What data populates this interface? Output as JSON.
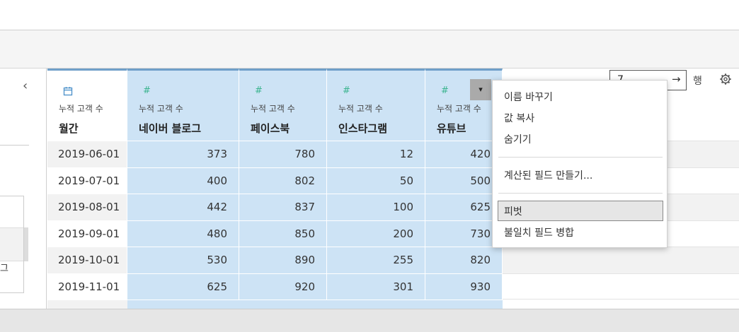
{
  "toolbar": {
    "rows_value": "7",
    "arrow": "→",
    "rows_label": "행"
  },
  "left_panel": {
    "collapse": "‹",
    "fragment": "그"
  },
  "columns": [
    {
      "icon": "calendar",
      "sub": "누적 고객 수",
      "name": "월간",
      "values": [
        "2019-06-01",
        "2019-07-01",
        "2019-08-01",
        "2019-09-01",
        "2019-10-01",
        "2019-11-01"
      ]
    },
    {
      "icon": "#",
      "sub": "누적 고객 수",
      "name": "네이버 블로그",
      "values": [
        "373",
        "400",
        "442",
        "480",
        "530",
        "625"
      ]
    },
    {
      "icon": "#",
      "sub": "누적 고객 수",
      "name": "페이스북",
      "values": [
        "780",
        "802",
        "837",
        "850",
        "890",
        "920"
      ]
    },
    {
      "icon": "#",
      "sub": "누적 고객 수",
      "name": "인스타그램",
      "values": [
        "12",
        "50",
        "100",
        "200",
        "255",
        "301"
      ]
    },
    {
      "icon": "#",
      "sub": "누적 고객 수",
      "name": "유튜브",
      "values": [
        "420",
        "500",
        "625",
        "730",
        "820",
        "930"
      ]
    }
  ],
  "dropdown_glyph": "▾",
  "menu": {
    "rename": "이름 바꾸기",
    "copy_values": "값 복사",
    "hide": "숨기기",
    "create_calc": "계산된 필드 만들기...",
    "pivot": "피벗",
    "merge_mismatched": "불일치 필드 병합"
  },
  "colors": {
    "accent_green": "#3bb48f",
    "selected_col": "#cde3f5",
    "date_col": "#f2f2f2",
    "header_top": "#6f9fc9"
  }
}
